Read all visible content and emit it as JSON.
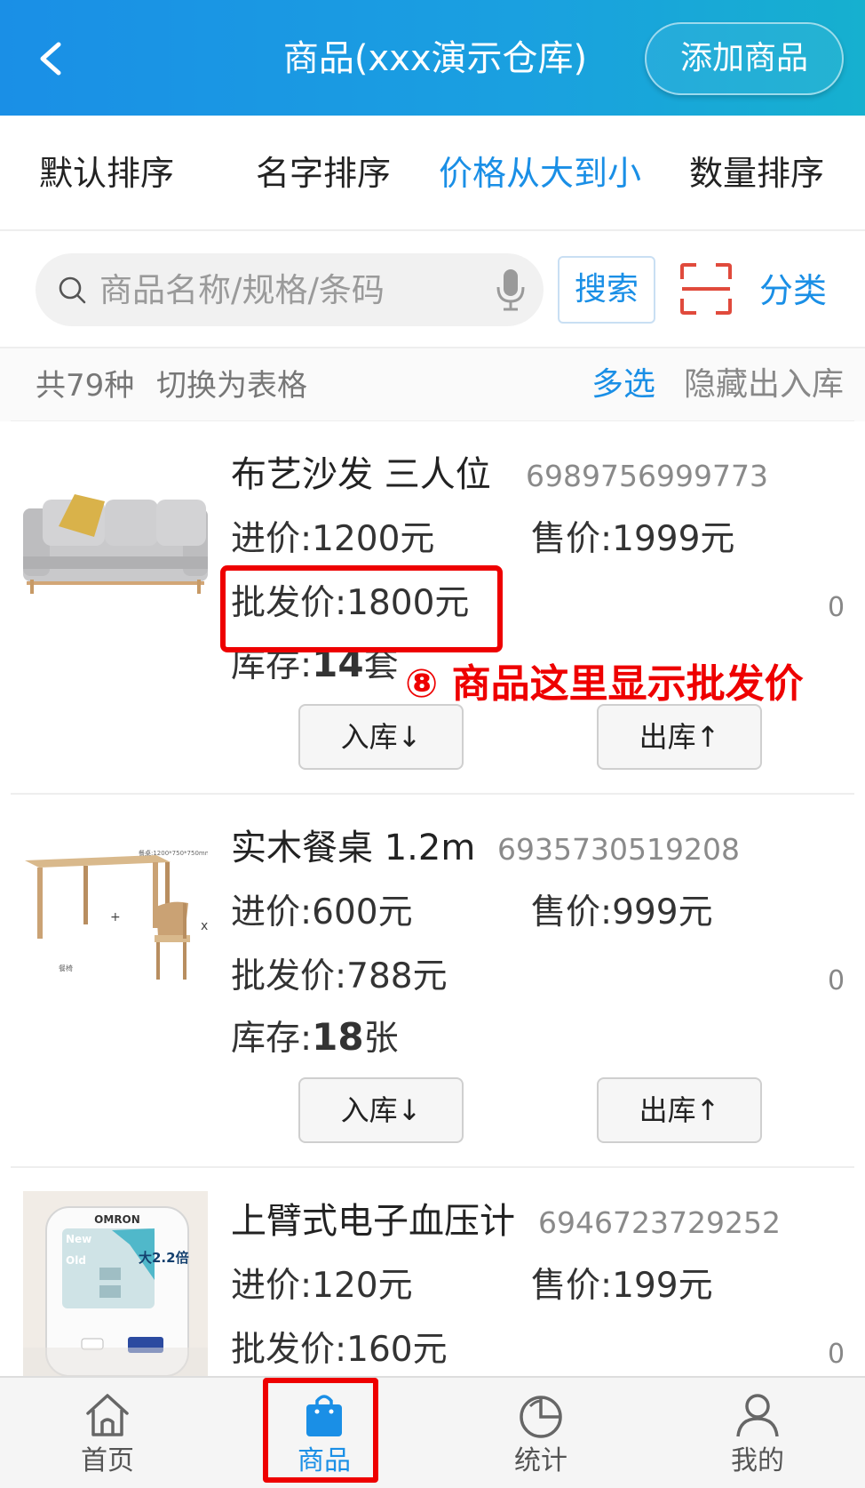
{
  "header": {
    "title": "商品(xxx演示仓库)",
    "add_button": "添加商品"
  },
  "sort_tabs": [
    {
      "label": "默认排序"
    },
    {
      "label": "名字排序"
    },
    {
      "label": "价格从大到小"
    },
    {
      "label": "数量排序"
    }
  ],
  "search": {
    "placeholder": "商品名称/规格/条码",
    "button": "搜索",
    "category": "分类"
  },
  "info": {
    "count": "共79种",
    "switch": "切换为表格",
    "multi": "多选",
    "hide": "隐藏出入库"
  },
  "labels": {
    "purchase": "进价:",
    "sale": "售价:",
    "wholesale": "批发价:",
    "stock": "库存:",
    "in_button": "入库↓",
    "out_button": "出库↑"
  },
  "products": [
    {
      "name": "布艺沙发  三人位",
      "code": "6989756999773",
      "purchase": "1200元",
      "sale": "1999元",
      "wholesale": "1800元",
      "count": "0",
      "stock_num": "14",
      "stock_unit": "套"
    },
    {
      "name": "实木餐桌  1.2m",
      "code": "6935730519208",
      "purchase": "600元",
      "sale": "999元",
      "wholesale": "788元",
      "count": "0",
      "stock_num": "18",
      "stock_unit": "张"
    },
    {
      "name": "上臂式电子血压计",
      "code": "6946723729252",
      "purchase": "120元",
      "sale": "199元",
      "wholesale": "160元",
      "count": "0"
    }
  ],
  "product_images": {
    "table_dims": "餐桌:1200*750*750mm",
    "table_plus": "+",
    "table_x": "x",
    "table_chair": "餐椅",
    "bp_brand": "OMRON",
    "bp_new": "New",
    "bp_old": "Old",
    "bp_badge": "大2.2倍"
  },
  "annotation": "⑧ 商品这里显示批发价",
  "bottom_nav": [
    {
      "label": "首页"
    },
    {
      "label": "商品"
    },
    {
      "label": "统计"
    },
    {
      "label": "我的"
    }
  ],
  "colors": {
    "brand_blue": "#1a8fe6",
    "annotation_red": "#ee0000"
  }
}
